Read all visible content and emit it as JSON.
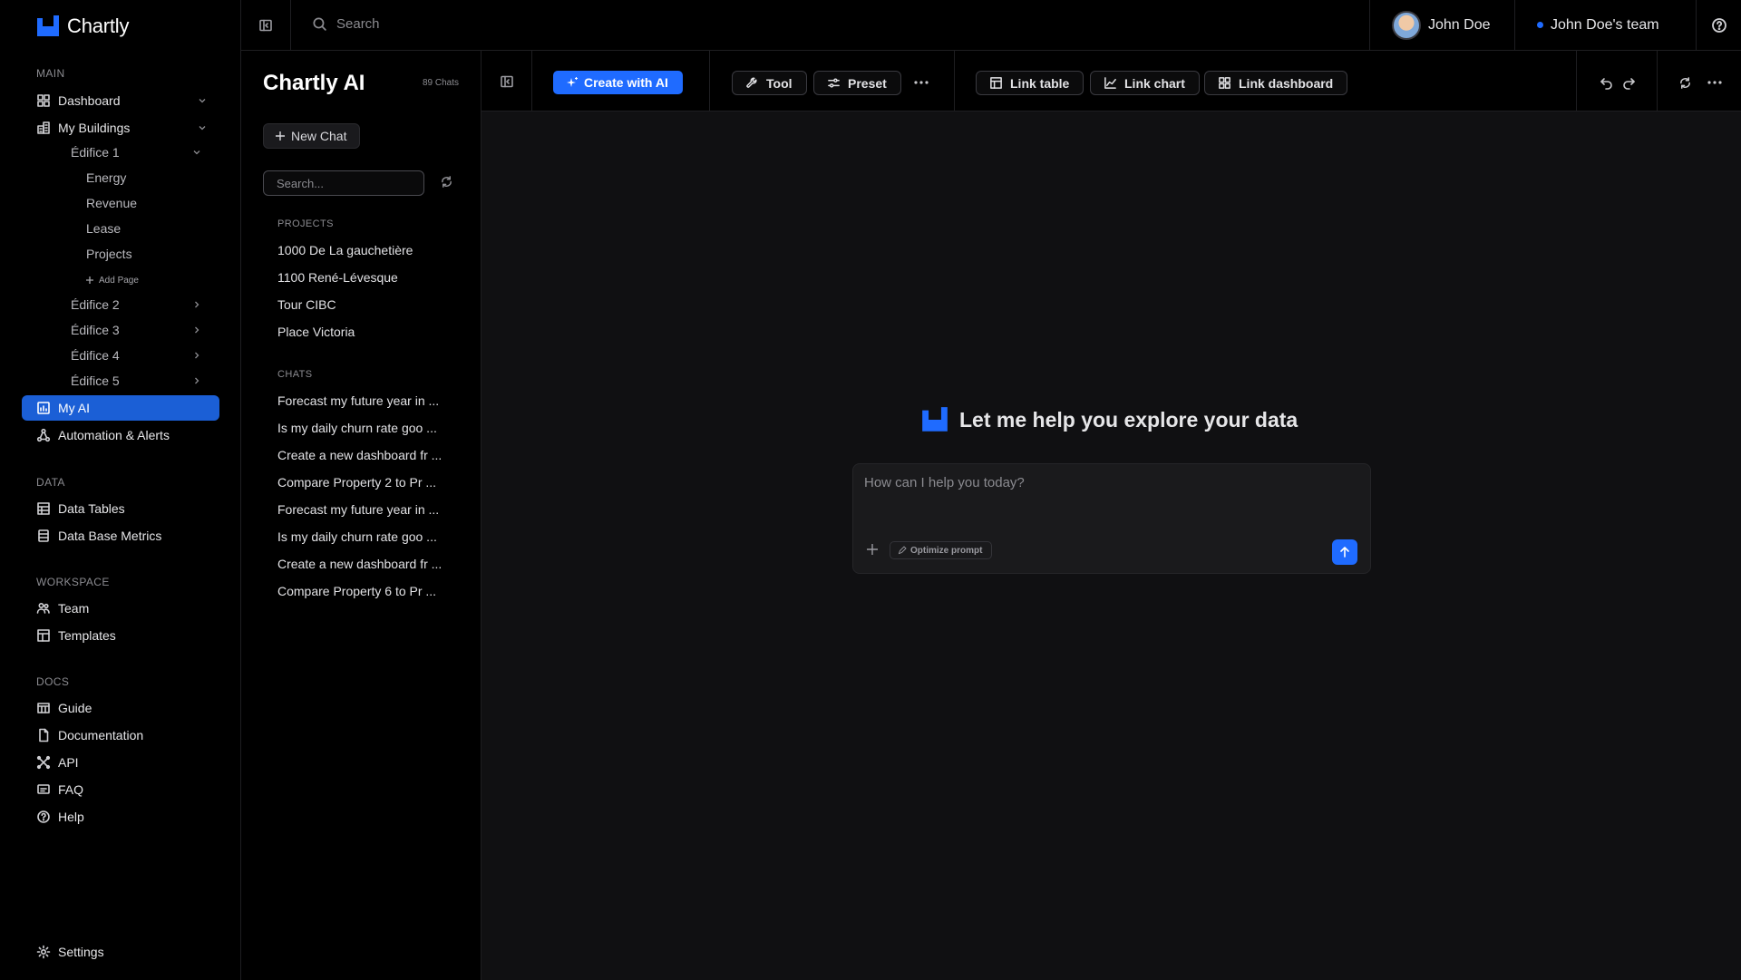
{
  "app": {
    "name": "Chartly",
    "accent": "#1f6bff",
    "active_bg": "#1b5fd6"
  },
  "sidebar": {
    "sections": {
      "main": "MAIN",
      "data": "DATA",
      "workspace": "WORKSPACE",
      "docs": "DOCS"
    },
    "dashboard": "Dashboard",
    "my_buildings": "My Buildings",
    "edifice1": "Édifice 1",
    "edifice1_pages": [
      "Energy",
      "Revenue",
      "Lease",
      "Projects"
    ],
    "add_page": "Add Page",
    "edifice2": "Édifice 2",
    "edifice3": "Édifice 3",
    "edifice4": "Édifice 4",
    "edifice5": "Édifice 5",
    "my_ai": "My AI",
    "automation": "Automation & Alerts",
    "data_tables": "Data Tables",
    "data_base_metrics": "Data Base Metrics",
    "team": "Team",
    "templates": "Templates",
    "guide": "Guide",
    "documentation": "Documentation",
    "api": "API",
    "faq": "FAQ",
    "help": "Help",
    "settings": "Settings"
  },
  "topbar": {
    "search_placeholder": "Search",
    "user_name": "John Doe",
    "team_name": "John Doe's team"
  },
  "chat_panel": {
    "title": "Chartly AI",
    "count": "89 Chats",
    "new_chat": "New Chat",
    "search_placeholder": "Search...",
    "projects_label": "PROJECTS",
    "projects": [
      "1000 De La gauchetière",
      "1100 René-Lévesque",
      "Tour CIBC",
      "Place Victoria"
    ],
    "chats_label": "CHATS",
    "chats": [
      "Forecast my future year in ...",
      "Is my daily churn rate goo ...",
      "Create a new dashboard fr ...",
      "Compare Property 2 to Pr ...",
      "Forecast my future year in ...",
      "Is my daily churn rate goo ...",
      "Create a new dashboard fr ...",
      "Compare Property 6 to Pr ..."
    ]
  },
  "toolbar": {
    "create_ai": "Create with AI",
    "tool": "Tool",
    "preset": "Preset",
    "link_table": "Link table",
    "link_chart": "Link chart",
    "link_dashboard": "Link dashboard"
  },
  "main": {
    "hero": "Let me help you explore your data",
    "composer_placeholder": "How can I help you today?",
    "optimize_prompt": "Optimize prompt"
  }
}
